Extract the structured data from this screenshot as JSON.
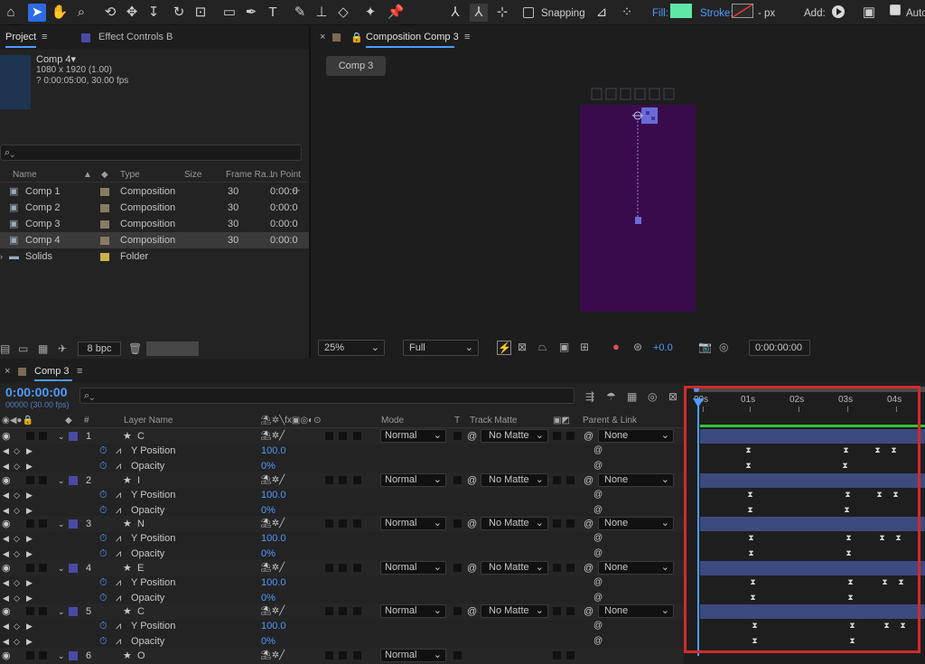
{
  "toolbar": {
    "snapping": "Snapping",
    "fill": "Fill:",
    "stroke": "Stroke:",
    "px": "- px",
    "add": "Add:",
    "auto": "Auto",
    "fill_color": "#5ee8a8"
  },
  "project": {
    "tab": "Project",
    "tab2": "Effect Controls B",
    "comp_name": "Comp 4",
    "comp_res": "1080 x 1920 (1.00)",
    "comp_dur": "? 0:00:05:00, 30.00 fps",
    "columns": {
      "name": "Name",
      "type": "Type",
      "size": "Size",
      "frame_rate": "Frame Ra...",
      "in_point": "In Point"
    },
    "items": [
      {
        "name": "Comp 1",
        "type": "Composition",
        "fr": "30",
        "in": "0:00:0"
      },
      {
        "name": "Comp 2",
        "type": "Composition",
        "fr": "30",
        "in": "0:00:0"
      },
      {
        "name": "Comp 3",
        "type": "Composition",
        "fr": "30",
        "in": "0:00:0"
      },
      {
        "name": "Comp 4",
        "type": "Composition",
        "fr": "30",
        "in": "0:00:0"
      },
      {
        "name": "Solids",
        "type": "Folder",
        "fr": "",
        "in": ""
      }
    ],
    "bpc": "8 bpc"
  },
  "viewer": {
    "tab": "Composition Comp 3",
    "crumb": "Comp 3",
    "zoom": "25%",
    "resolution": "Full",
    "exposure": "+0.0",
    "timecode": "0:00:00:00"
  },
  "timeline": {
    "tab": "Comp 3",
    "timecode": "0:00:00:00",
    "frames": "00000 (30.00 fps)",
    "headers": {
      "layer_name": "Layer Name",
      "mode": "Mode",
      "t": "T",
      "track_matte": "Track Matte",
      "parent": "Parent & Link"
    },
    "ruler": [
      "00s",
      "01s",
      "02s",
      "03s",
      "04s"
    ],
    "prop_y": "Y Position",
    "prop_op": "Opacity",
    "layers": [
      {
        "num": "1",
        "name": "C",
        "mode": "Normal",
        "matte": "No Matte",
        "parent": "None",
        "y": "100.0",
        "op": "0%"
      },
      {
        "num": "2",
        "name": "I",
        "mode": "Normal",
        "matte": "No Matte",
        "parent": "None",
        "y": "100.0",
        "op": "0%"
      },
      {
        "num": "3",
        "name": "N",
        "mode": "Normal",
        "matte": "No Matte",
        "parent": "None",
        "y": "100.0",
        "op": "0%"
      },
      {
        "num": "4",
        "name": "E",
        "mode": "Normal",
        "matte": "No Matte",
        "parent": "None",
        "y": "100.0",
        "op": "0%"
      },
      {
        "num": "5",
        "name": "C",
        "mode": "Normal",
        "matte": "No Matte",
        "parent": "None",
        "y": "100.0",
        "op": "0%"
      },
      {
        "num": "6",
        "name": "O",
        "mode": "Normal",
        "matte": "",
        "parent": "",
        "y": "",
        "op": ""
      }
    ],
    "highlight_color": "#d42a2a"
  }
}
